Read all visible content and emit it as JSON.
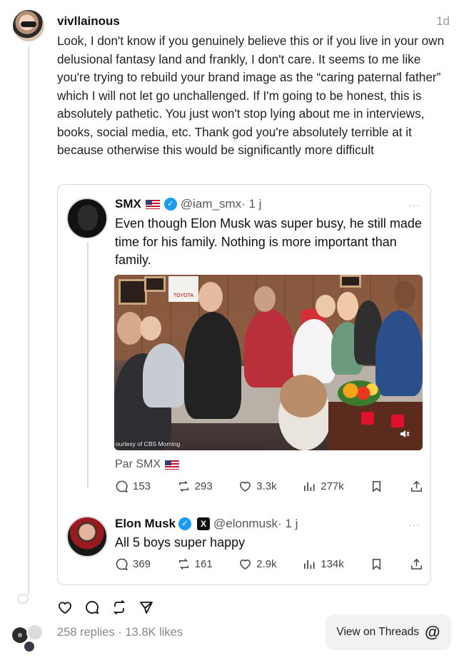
{
  "post": {
    "username": "vivllainous",
    "time": "1d",
    "text": "Look, I don't know if you genuinely believe this or if you live in your own delusional fantasy land and frankly, I don't care. It seems to me like you're trying to rebuild your brand image as the “caring paternal father” which I will not let go unchallenged.  If I'm going to be honest, this is absolutely pathetic. You just won't stop lying about me in interviews, books, social media, etc. Thank god you're absolutely terrible at it because otherwise this would be significantly more difficult"
  },
  "quoted": {
    "name": "SMX",
    "handle": "@iam_smx",
    "time": "· 1 j",
    "more": "···",
    "text": "Even though Elon Musk was super busy, he still made time for his family. Nothing is more important than family.",
    "media_caption": "ourtesy of CBS Morning",
    "media_logo": "TOYOTA",
    "par_label": "Par SMX",
    "stats": {
      "replies": "153",
      "reposts": "293",
      "likes": "3.3k",
      "views": "277k"
    }
  },
  "reply": {
    "name": "Elon Musk",
    "handle": "@elonmusk",
    "time": "· 1 j",
    "more": "···",
    "text": "All 5 boys super happy",
    "stats": {
      "replies": "369",
      "reposts": "161",
      "likes": "2.9k",
      "views": "134k"
    }
  },
  "footer": {
    "summary": "258 replies · 13.8K likes",
    "view_button": "View on Threads",
    "threads_logo": "@"
  },
  "icons": [
    "heart-icon",
    "comment-icon",
    "repost-icon",
    "share-icon",
    "views-icon",
    "bookmark-icon",
    "upload-icon",
    "threads-logo-icon"
  ],
  "colors": {
    "verified": "#1d9bf0",
    "muted_text": "#888888",
    "button_bg": "#f2f2f2"
  }
}
